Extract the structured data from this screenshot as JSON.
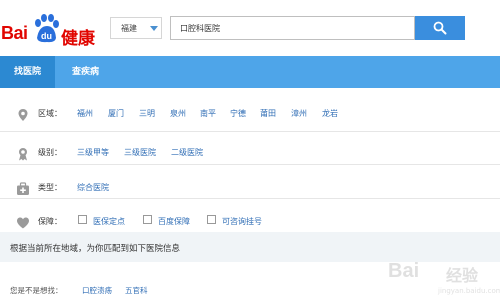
{
  "header": {
    "logo_text_latin": "Bai",
    "logo_text_paw": "du",
    "logo_text_cn": "健康",
    "city": "福建",
    "search_value": "口腔科医院"
  },
  "nav": {
    "tabs": [
      "找医院",
      "查疾病"
    ]
  },
  "filters": {
    "region": {
      "label": "区域：",
      "options": [
        "福州",
        "厦门",
        "三明",
        "泉州",
        "南平",
        "宁德",
        "莆田",
        "漳州",
        "龙岩"
      ]
    },
    "level": {
      "label": "级别：",
      "options": [
        "三级甲等",
        "三级医院",
        "二级医院"
      ]
    },
    "type": {
      "label": "类型：",
      "options": [
        "综合医院"
      ]
    },
    "guarantee": {
      "label": "保障：",
      "options": [
        "医保定点",
        "百度保障",
        "可咨询挂号"
      ]
    }
  },
  "info_text": "根据当前所在地域，为你匹配到如下医院信息",
  "suggest": {
    "label": "您是不是想找：",
    "links": [
      "口腔溃疡",
      "五官科"
    ]
  },
  "watermark": {
    "text1": "Bai",
    "text2": "经验",
    "text3": "jingyan.baidu.com"
  },
  "colors": {
    "brand_red": "#e10601",
    "nav_blue": "#4ea5e9",
    "nav_active": "#2c89d2",
    "link_blue": "#2f6db5",
    "search_button": "#3a8ede"
  }
}
